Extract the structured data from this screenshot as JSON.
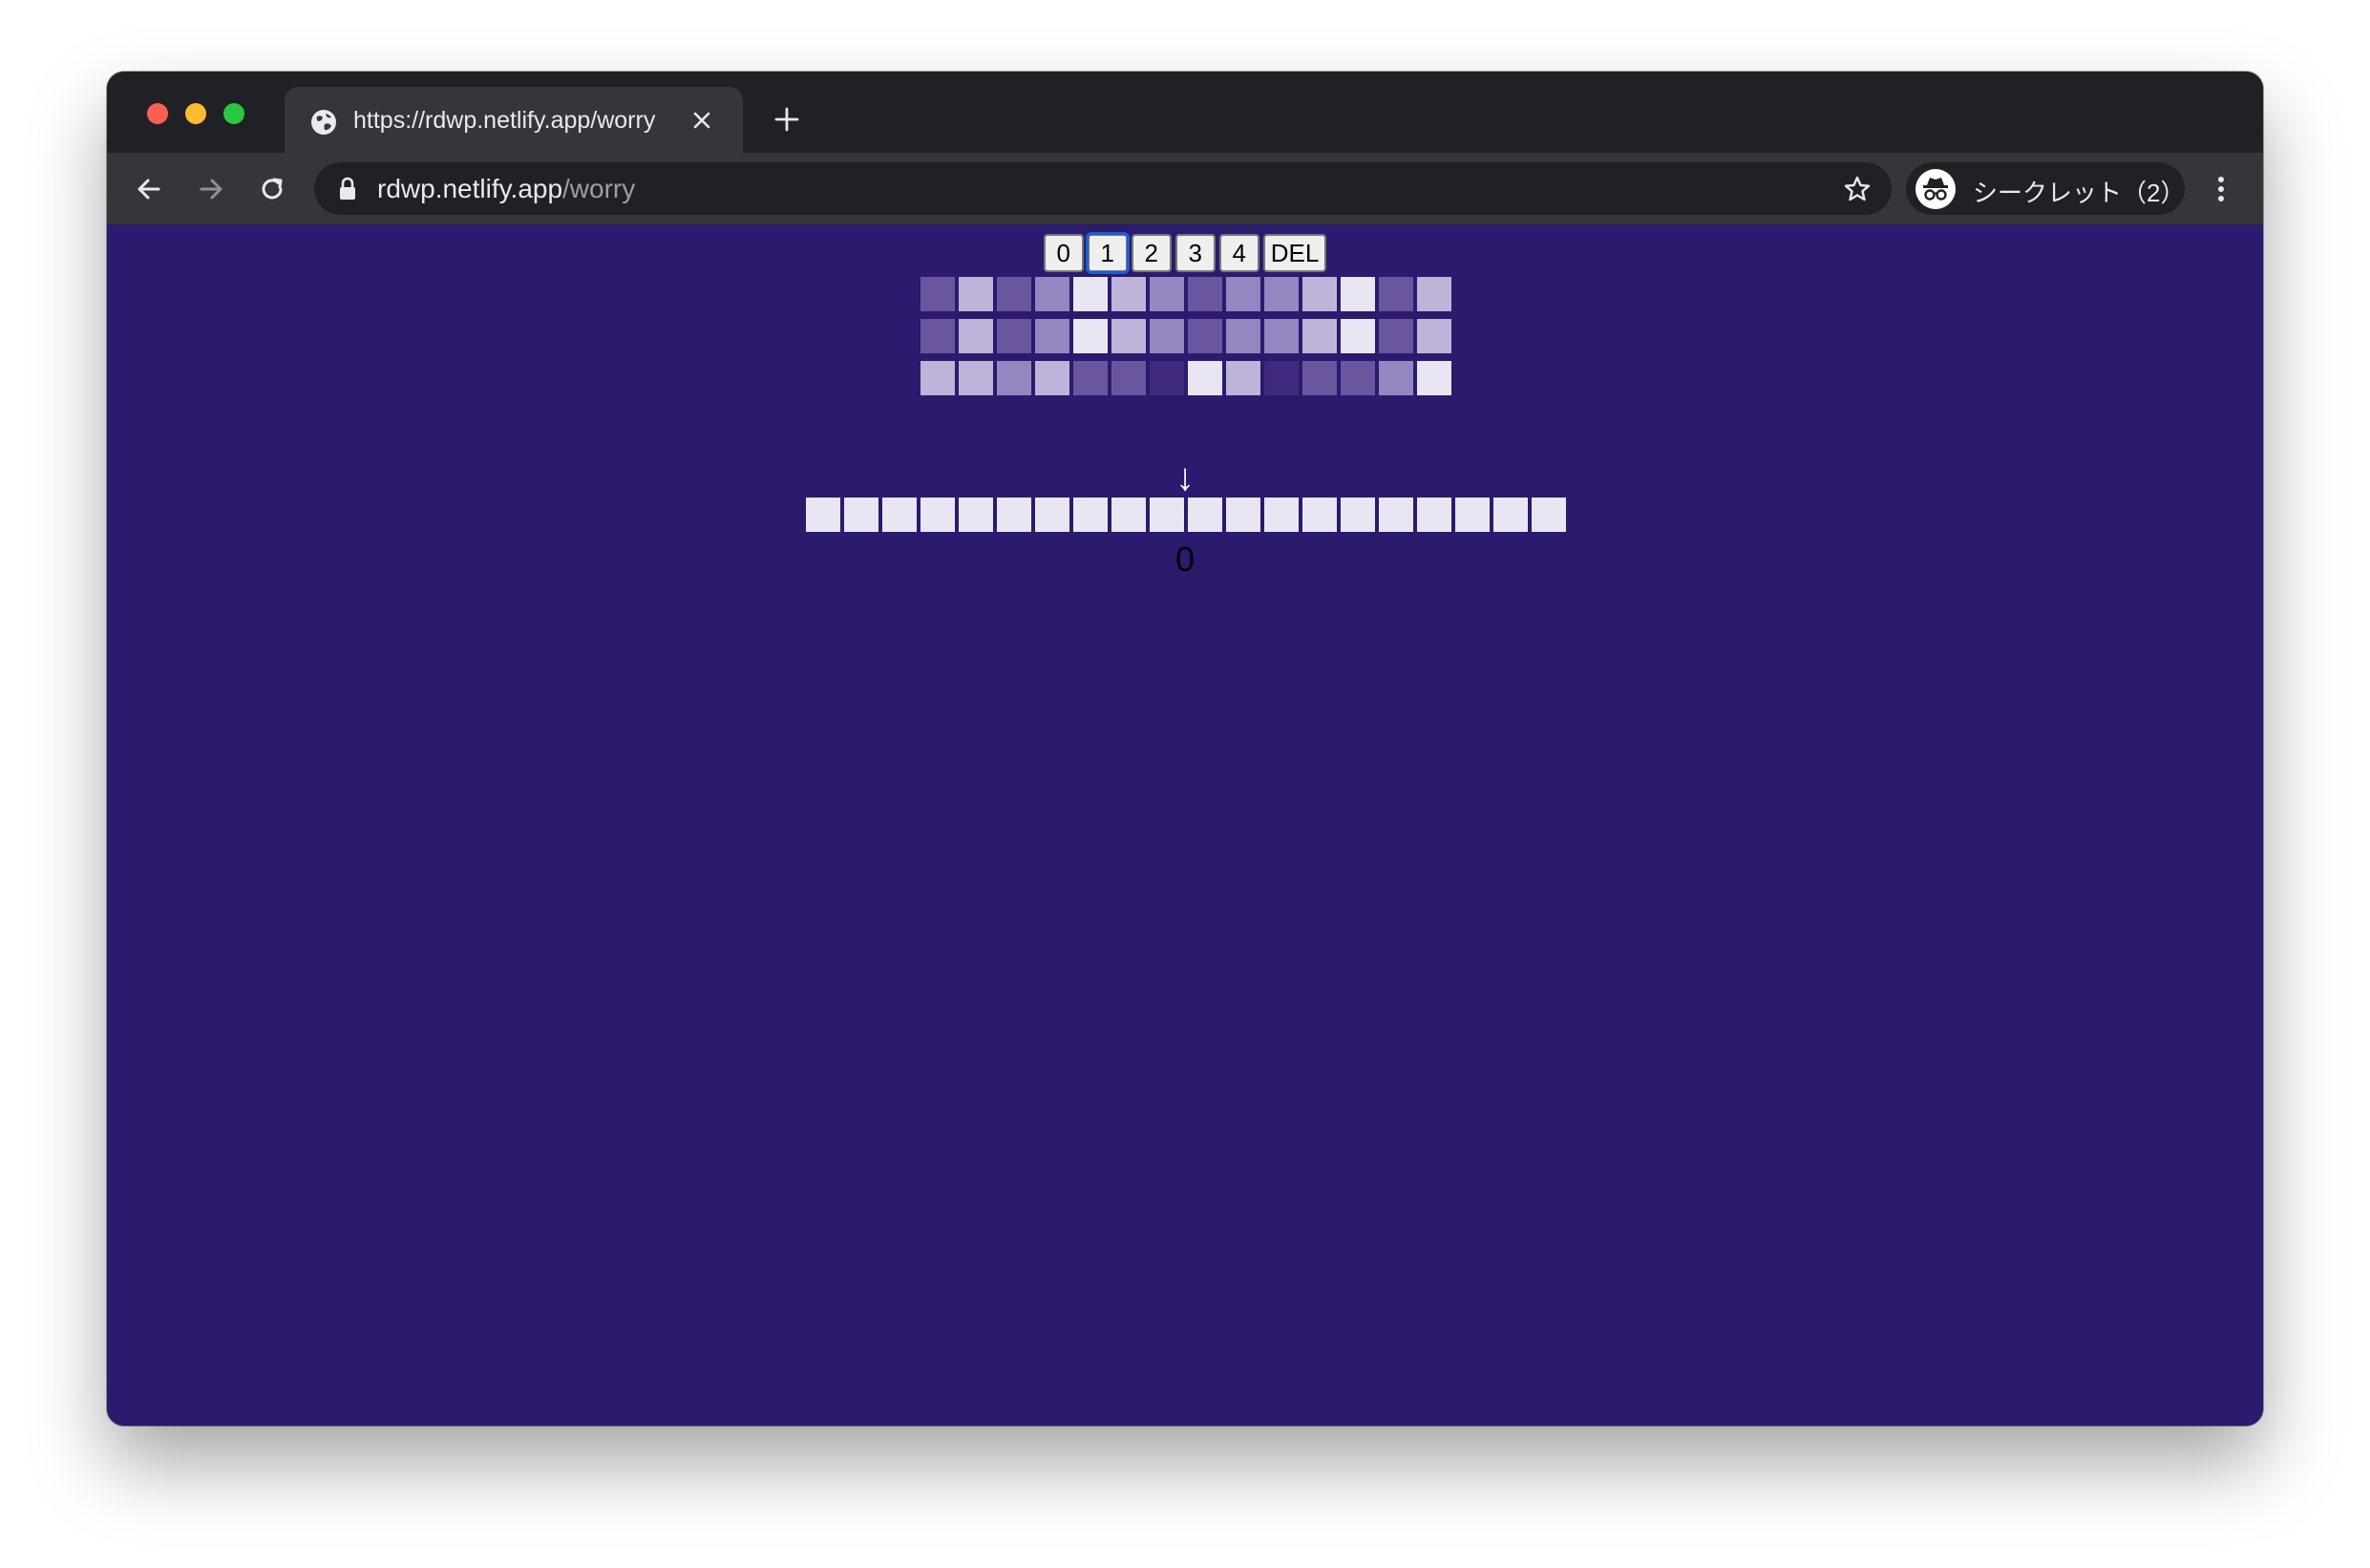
{
  "browser": {
    "tab_title": "https://rdwp.netlify.app/worry",
    "url_host": "rdwp.netlify.app",
    "url_path": "/worry",
    "profile_label": "シークレット（2）",
    "colors": {
      "frame": "#202124",
      "toolbar": "#35363a",
      "text": "#e8eaed"
    }
  },
  "page": {
    "background": "#2b1a6d",
    "buttons": [
      {
        "label": "0",
        "focused": false
      },
      {
        "label": "1",
        "focused": true
      },
      {
        "label": "2",
        "focused": false
      },
      {
        "label": "3",
        "focused": false
      },
      {
        "label": "4",
        "focused": false
      },
      {
        "label": "DEL",
        "focused": false
      }
    ],
    "palette": [
      "#3f2a80",
      "#6a559f",
      "#9585c0",
      "#beb3d9",
      "#e9e6f4"
    ],
    "grid": [
      [
        1,
        3,
        1,
        2,
        4,
        3,
        2,
        1,
        2,
        2,
        3,
        4,
        1,
        3
      ],
      [
        1,
        3,
        1,
        2,
        4,
        3,
        2,
        1,
        2,
        2,
        3,
        4,
        1,
        3
      ],
      [
        3,
        3,
        2,
        3,
        1,
        1,
        0,
        4,
        3,
        0,
        1,
        1,
        2,
        4
      ]
    ],
    "arrow": "↓",
    "output": [
      4,
      4,
      4,
      4,
      4,
      4,
      4,
      4,
      4,
      4,
      4,
      4,
      4,
      4,
      4,
      4,
      4,
      4,
      4,
      4
    ],
    "count": "0"
  }
}
